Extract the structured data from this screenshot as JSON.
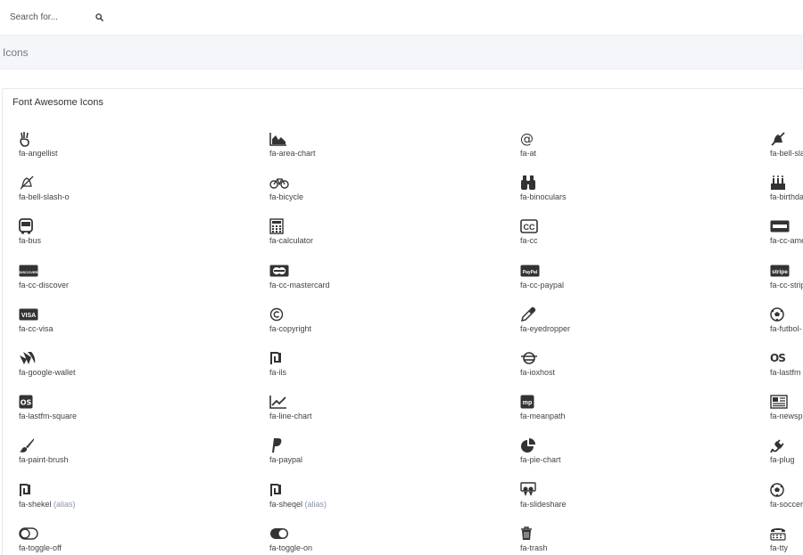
{
  "search": {
    "placeholder": "Search for..."
  },
  "page": {
    "title": "Icons"
  },
  "card": {
    "title": "Font Awesome Icons"
  },
  "alias_label": "(alias)",
  "icons": [
    {
      "name": "fa-angellist"
    },
    {
      "name": "fa-area-chart"
    },
    {
      "name": "fa-at"
    },
    {
      "name": "fa-bell-sla"
    },
    {
      "name": "fa-bell-slash-o"
    },
    {
      "name": "fa-bicycle"
    },
    {
      "name": "fa-binoculars"
    },
    {
      "name": "fa-birthda"
    },
    {
      "name": "fa-bus"
    },
    {
      "name": "fa-calculator"
    },
    {
      "name": "fa-cc"
    },
    {
      "name": "fa-cc-ame"
    },
    {
      "name": "fa-cc-discover"
    },
    {
      "name": "fa-cc-mastercard"
    },
    {
      "name": "fa-cc-paypal"
    },
    {
      "name": "fa-cc-strip"
    },
    {
      "name": "fa-cc-visa"
    },
    {
      "name": "fa-copyright"
    },
    {
      "name": "fa-eyedropper"
    },
    {
      "name": "fa-futbol-"
    },
    {
      "name": "fa-google-wallet"
    },
    {
      "name": "fa-ils"
    },
    {
      "name": "fa-ioxhost"
    },
    {
      "name": "fa-lastfm"
    },
    {
      "name": "fa-lastfm-square"
    },
    {
      "name": "fa-line-chart"
    },
    {
      "name": "fa-meanpath"
    },
    {
      "name": "fa-newsp"
    },
    {
      "name": "fa-paint-brush"
    },
    {
      "name": "fa-paypal"
    },
    {
      "name": "fa-pie-chart"
    },
    {
      "name": "fa-plug"
    },
    {
      "name": "fa-shekel",
      "alias": true
    },
    {
      "name": "fa-sheqel",
      "alias": true
    },
    {
      "name": "fa-slideshare"
    },
    {
      "name": "fa-soccer"
    },
    {
      "name": "fa-toggle-off"
    },
    {
      "name": "fa-toggle-on"
    },
    {
      "name": "fa-trash"
    },
    {
      "name": "fa-tty"
    }
  ],
  "card_texts": {
    "cc-discover": "DISCOVER",
    "cc-paypal": "PayPal",
    "cc-stripe": "stripe",
    "cc-visa": "VISA",
    "meanpath": "mp",
    "lastfm": "OS",
    "cc": "CC"
  }
}
